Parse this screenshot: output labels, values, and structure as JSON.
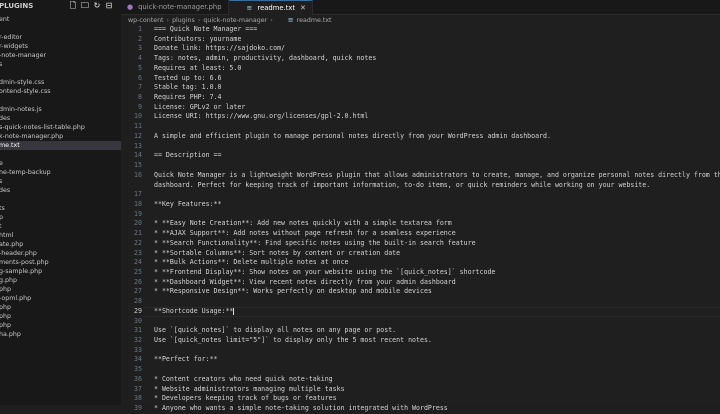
{
  "sidebar": {
    "title": "PLUGINS",
    "items": [
      {
        "label": "ent"
      },
      {
        "label": ""
      },
      {
        "label": "r-editor"
      },
      {
        "label": "r-widgets"
      },
      {
        "label": "-note-manager"
      },
      {
        "label": "s"
      },
      {
        "label": ""
      },
      {
        "label": "dmin-style.css"
      },
      {
        "label": "ontend-style.css"
      },
      {
        "label": ""
      },
      {
        "label": "dmin-notes.js"
      },
      {
        "label": "des"
      },
      {
        "label": "s-quick-notes-list-table.php"
      },
      {
        "label": "k-note-manager.php"
      },
      {
        "label": "me.txt"
      },
      {
        "label": ""
      },
      {
        "label": "e"
      },
      {
        "label": "ne-temp-backup"
      },
      {
        "label": "s"
      },
      {
        "label": "des"
      },
      {
        "label": ""
      },
      {
        "label": "ts"
      },
      {
        "label": "p"
      },
      {
        "label": "t"
      },
      {
        "label": "html"
      },
      {
        "label": "ate.php"
      },
      {
        "label": "-header.php"
      },
      {
        "label": "ments-post.php"
      },
      {
        "label": "g-sample.php"
      },
      {
        "label": "g.php"
      },
      {
        "label": "php"
      },
      {
        "label": "-opml.php"
      },
      {
        "label": "php"
      },
      {
        "label": "php"
      },
      {
        "label": "php"
      },
      {
        "label": "ha.php"
      }
    ]
  },
  "tabs": [
    {
      "label": "quick-note-manager.php",
      "icon": "php-icon"
    },
    {
      "label": "readme.txt",
      "icon": "text-file-icon"
    }
  ],
  "breadcrumb": [
    "wp-content",
    "plugins",
    "quick-note-manager",
    "readme.txt"
  ],
  "current_line": 20,
  "lines": [
    {
      "n": "1",
      "text": "=== Quick Note Manager ==="
    },
    {
      "n": "2",
      "text": "Contributors: yourname"
    },
    {
      "n": "3",
      "text": "Donate link: https://sajdoko.com/"
    },
    {
      "n": "4",
      "text": "Tags: notes, admin, productivity, dashboard, quick notes"
    },
    {
      "n": "5",
      "text": "Requires at least: 5.0"
    },
    {
      "n": "6",
      "text": "Tested up to: 6.6"
    },
    {
      "n": "7",
      "text": "Stable tag: 1.0.0"
    },
    {
      "n": "8",
      "text": "Requires PHP: 7.4"
    },
    {
      "n": "9",
      "text": "License: GPLv2 or later"
    },
    {
      "n": "10",
      "text": "License URI: https://www.gnu.org/licenses/gpl-2.0.html"
    },
    {
      "n": "11",
      "text": ""
    },
    {
      "n": "12",
      "text": "A simple and efficient plugin to manage personal notes directly from your WordPress admin dashboard."
    },
    {
      "n": "13",
      "text": ""
    },
    {
      "n": "14",
      "text": "== Description =="
    },
    {
      "n": "15",
      "text": ""
    },
    {
      "n": "16",
      "text": "Quick Note Manager is a lightweight WordPress plugin that allows administrators to create, manage, and organize personal notes directly from the Wo"
    },
    {
      "n": "",
      "text": "dashboard. Perfect for keeping track of important information, to-do items, or quick reminders while working on your website."
    },
    {
      "n": "17",
      "text": ""
    },
    {
      "n": "18",
      "text": "**Key Features:**"
    },
    {
      "n": "19",
      "text": ""
    },
    {
      "n": "20",
      "text": "* **Easy Note Creation**: Add new notes quickly with a simple textarea form"
    },
    {
      "n": "21",
      "text": "* **AJAX Support**: Add notes without page refresh for a seamless experience"
    },
    {
      "n": "22",
      "text": "* **Search Functionality**: Find specific notes using the built-in search feature"
    },
    {
      "n": "23",
      "text": "* **Sortable Columns**: Sort notes by content or creation date"
    },
    {
      "n": "24",
      "text": "* **Bulk Actions**: Delete multiple notes at once"
    },
    {
      "n": "25",
      "text": "* **Frontend Display**: Show notes on your website using the `[quick_notes]` shortcode"
    },
    {
      "n": "26",
      "text": "* **Dashboard Widget**: View recent notes directly from your admin dashboard"
    },
    {
      "n": "27",
      "text": "* **Responsive Design**: Works perfectly on desktop and mobile devices"
    },
    {
      "n": "28",
      "text": ""
    },
    {
      "n": "29",
      "text": "**Shortcode Usage:**"
    },
    {
      "n": "30",
      "text": ""
    },
    {
      "n": "31",
      "text": "Use `[quick_notes]` to display all notes on any page or post."
    },
    {
      "n": "32",
      "text": "Use `[quick_notes limit=\"5\"]` to display only the 5 most recent notes."
    },
    {
      "n": "33",
      "text": ""
    },
    {
      "n": "34",
      "text": "**Perfect for:**"
    },
    {
      "n": "35",
      "text": ""
    },
    {
      "n": "36",
      "text": "* Content creators who need quick note-taking"
    },
    {
      "n": "37",
      "text": "* Website administrators managing multiple tasks"
    },
    {
      "n": "38",
      "text": "* Developers keeping track of bugs or features"
    },
    {
      "n": "39",
      "text": "* Anyone who wants a simple note-taking solution integrated with WordPress"
    }
  ]
}
